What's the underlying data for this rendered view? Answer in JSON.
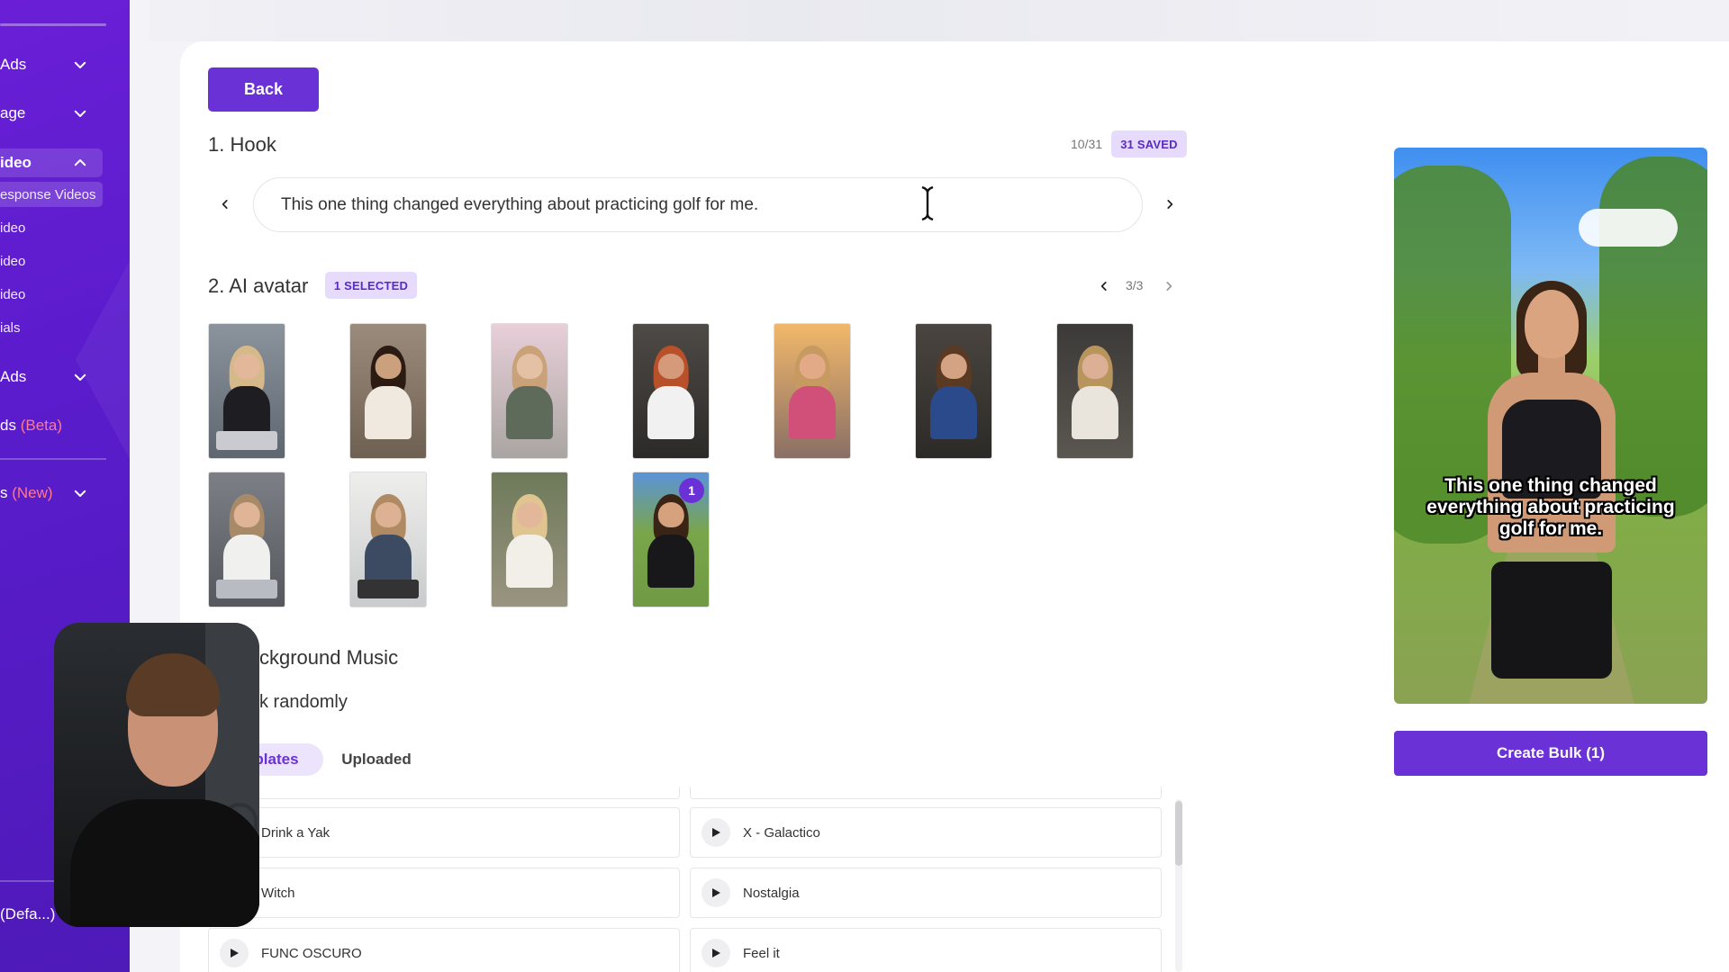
{
  "sidebar": {
    "items": [
      {
        "label": "Ads",
        "chevron": "down"
      },
      {
        "label": "age",
        "chevron": "down"
      },
      {
        "label": "ideo",
        "chevron": "up",
        "active": true
      }
    ],
    "subitems": [
      "esponse Videos",
      "ideo",
      "ideo",
      "ideo",
      "ials"
    ],
    "items2": [
      {
        "label": "Ads",
        "chevron": "down"
      }
    ],
    "beta_prefix": "ds",
    "beta_tag": "(Beta)",
    "new_prefix": "s",
    "new_tag": "(New)",
    "bottom_label": "(Defa...)"
  },
  "back_button": "Back",
  "hook": {
    "title": "1. Hook",
    "counter": "10/31",
    "saved_badge": "31 SAVED",
    "text": "This one thing changed everything about practicing golf for me."
  },
  "avatar_section": {
    "title": "2. AI avatar",
    "selected_badge": "1 SELECTED",
    "pager": "3/3",
    "selected_number": "1"
  },
  "music": {
    "title_partial": "ckground Music",
    "pick_partial": "k randomly",
    "tabs": [
      "plates",
      "Uploaded"
    ],
    "tracks_left": [
      "Drink a Yak",
      "Witch",
      "FUNC OSCURO"
    ],
    "tracks_right": [
      "X - Galactico",
      "Nostalgia",
      "Feel it"
    ]
  },
  "preview": {
    "caption": "This one thing changed everything about practicing golf for me."
  },
  "create_button": "Create Bulk (1)"
}
